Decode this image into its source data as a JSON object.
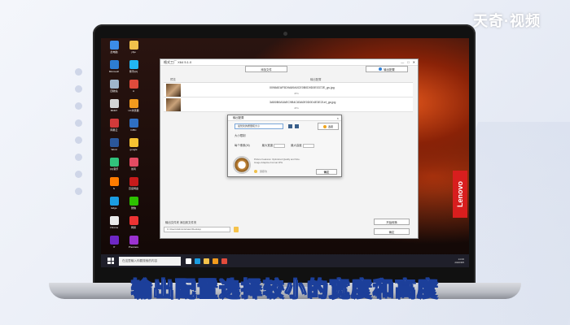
{
  "watermark": "天奇·视频",
  "subtitle": "输出配置选择较小的宽度和高度",
  "brand": {
    "name": "Lenovo",
    "color": "#d81e1e"
  },
  "desktop": {
    "icons": [
      {
        "label": "此电脑",
        "color": "#3c8ce7"
      },
      {
        "label": "yhjo",
        "color": "#f0c14b"
      },
      {
        "label": "Microsoft",
        "color": "#2d7dd2"
      },
      {
        "label": "腾讯QQ",
        "color": "#22b7f2"
      },
      {
        "label": "回收站",
        "color": "#9fb6cc"
      },
      {
        "label": "A",
        "color": "#e14b3b"
      },
      {
        "label": "BKMT",
        "color": "#d4d4d4"
      },
      {
        "label": "UC浏览器",
        "color": "#f29b1d"
      },
      {
        "label": "网易云",
        "color": "#d23a3a"
      },
      {
        "label": "ICBC",
        "color": "#2f6fc2"
      },
      {
        "label": "Word",
        "color": "#2b579a"
      },
      {
        "label": "google",
        "color": "#f6c232"
      },
      {
        "label": "QQ音乐",
        "color": "#31c27c"
      },
      {
        "label": "暴风",
        "color": "#e24b62"
      },
      {
        "label": "Ai",
        "color": "#ff7c00"
      },
      {
        "label": "百度网盘",
        "color": "#c81b1b"
      },
      {
        "label": "Edge",
        "color": "#1b9de2"
      },
      {
        "label": "微信",
        "color": "#2dc100"
      },
      {
        "label": "Chrome",
        "color": "#eaeaea"
      },
      {
        "label": "网易",
        "color": "#e33"
      },
      {
        "label": "Pr",
        "color": "#6e27c5"
      },
      {
        "label": "Premiere",
        "color": "#9a32d0"
      }
    ]
  },
  "main_window": {
    "title": "格式工厂 X64 5.1.0",
    "controls": [
      "—",
      "□",
      "✕"
    ],
    "btn_add": "添加文件",
    "btn_output": "输出配置",
    "col_preview": "预览",
    "col_output": "输出配置",
    "files": [
      {
        "name": "0098AEAF5D9A89A0CE0B0D9D0E0372E_gs.jpg",
        "sub": "JPG"
      },
      {
        "name": "3AB0B0A5AEC9B4C83A0E0D0D4E3E21ef_gs.jpg",
        "sub": "JPG"
      }
    ],
    "output_label": "输出文件夹  添加到文件夹",
    "output_path": "C:\\Users\\Administrator\\Desktop",
    "btn_start": "开始转换",
    "btn_ok": "确定"
  },
  "dialog": {
    "title": "输出配置",
    "preset": "最优化的质量和大小",
    "btn_settings": "选项",
    "row1_label": "大小限制",
    "row2_label": "每个像素(M)",
    "width_label": "最大宽度",
    "height_label": "最大高度",
    "desc": "Picture Features: Optimized Quality and Size. Image Adaptive Format JPG",
    "progress_label": "另存为",
    "btn_ok": "确定"
  },
  "taskbar": {
    "search_placeholder": "在这里输入你要搜索的内容",
    "time": "14:06",
    "date": "2020/8/5"
  }
}
